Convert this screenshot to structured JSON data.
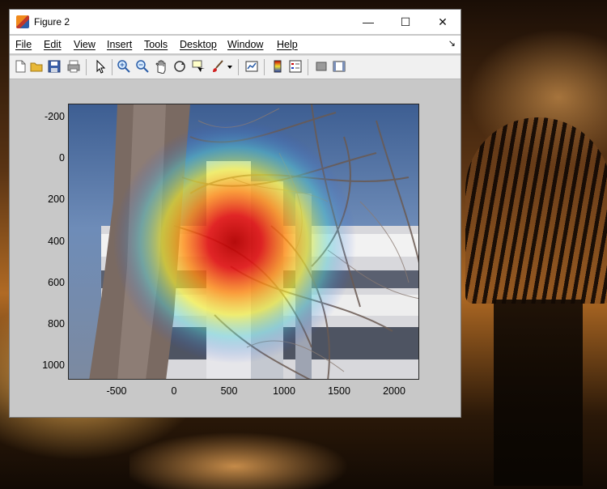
{
  "window": {
    "title": "Figure 2",
    "minimize_glyph": "—",
    "maximize_glyph": "☐",
    "close_glyph": "✕"
  },
  "menu": {
    "items": [
      {
        "label": "File"
      },
      {
        "label": "Edit"
      },
      {
        "label": "View"
      },
      {
        "label": "Insert"
      },
      {
        "label": "Tools"
      },
      {
        "label": "Desktop"
      },
      {
        "label": "Window"
      },
      {
        "label": "Help"
      }
    ],
    "dock_glyph": "↘"
  },
  "toolbar": {
    "buttons": [
      {
        "name": "new-figure-icon"
      },
      {
        "name": "open-file-icon"
      },
      {
        "name": "save-icon"
      },
      {
        "name": "print-icon"
      },
      {
        "name": "edit-plot-arrow-icon"
      },
      {
        "name": "zoom-in-icon"
      },
      {
        "name": "zoom-out-icon"
      },
      {
        "name": "pan-hand-icon"
      },
      {
        "name": "rotate-3d-icon"
      },
      {
        "name": "data-cursor-icon"
      },
      {
        "name": "brush-icon"
      },
      {
        "name": "brush-dropdown-icon"
      },
      {
        "name": "link-plot-icon"
      },
      {
        "name": "insert-colorbar-icon"
      },
      {
        "name": "insert-legend-icon"
      },
      {
        "name": "hide-plot-tools-icon"
      },
      {
        "name": "show-plot-tools-icon"
      }
    ]
  },
  "axes": {
    "y_ticks": [
      "-200",
      "0",
      "200",
      "400",
      "600",
      "800",
      "1000"
    ],
    "x_ticks": [
      "-500",
      "0",
      "500",
      "1000",
      "1500",
      "2000"
    ]
  },
  "colors": {
    "figure_bg": "#c8c8c8",
    "heatmap_peak": "#c80000",
    "sky": "#4a6e9e"
  }
}
